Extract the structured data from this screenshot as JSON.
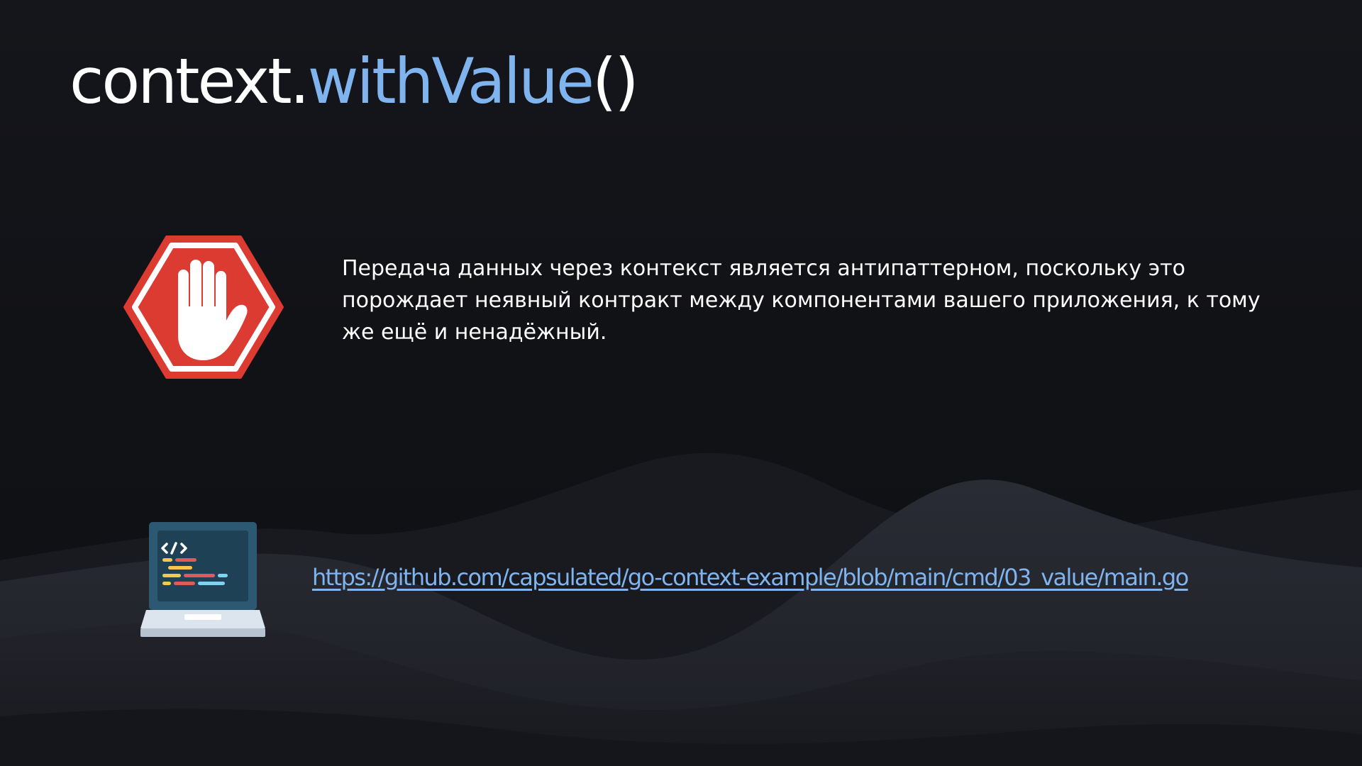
{
  "slide": {
    "title": {
      "object": "context.",
      "method": "withValue",
      "parens": "()"
    },
    "warning_text": "Передача данных через контекст является антипаттерном, поскольку это порождает неявный контракт между компонентами вашего приложения, к тому же ещё и ненадёжный.",
    "link_text": "https://github.com/capsulated/go-context-example/blob/main/cmd/03_value/main.go",
    "icons": {
      "stop": "stop-hand-icon",
      "code": "laptop-code-icon"
    }
  },
  "colors": {
    "background": "#121317",
    "title": "#ffffff",
    "accent": "#7fb4ee",
    "stop_red": "#dc3b32"
  }
}
